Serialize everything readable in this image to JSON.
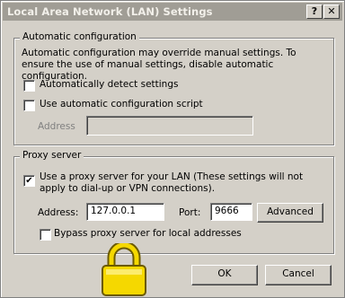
{
  "window": {
    "title": "Local Area Network (LAN) Settings",
    "help_glyph": "?",
    "close_glyph": "✕"
  },
  "auto_config": {
    "legend": "Automatic configuration",
    "description": "Automatic configuration may override manual settings.  To ensure the use of manual settings, disable automatic configuration.",
    "detect_label": "Automatically detect settings",
    "detect_checked": false,
    "script_label": "Use automatic configuration script",
    "script_checked": false,
    "address_label": "Address",
    "address_value": ""
  },
  "proxy": {
    "legend": "Proxy server",
    "use_proxy_label": "Use a proxy server for your LAN (These settings will not apply to dial-up or VPN connections).",
    "use_proxy_checked": true,
    "check_glyph": "✔",
    "address_label": "Address:",
    "address_value": "127.0.0.1",
    "port_label": "Port:",
    "port_value": "9666",
    "advanced_label": "Advanced",
    "bypass_label": "Bypass proxy server for local addresses",
    "bypass_checked": false
  },
  "buttons": {
    "ok": "OK",
    "cancel": "Cancel"
  },
  "overlay": {
    "icon": "lock-icon",
    "colors": {
      "body": "#f5d800",
      "outline": "#6b5a00"
    }
  }
}
